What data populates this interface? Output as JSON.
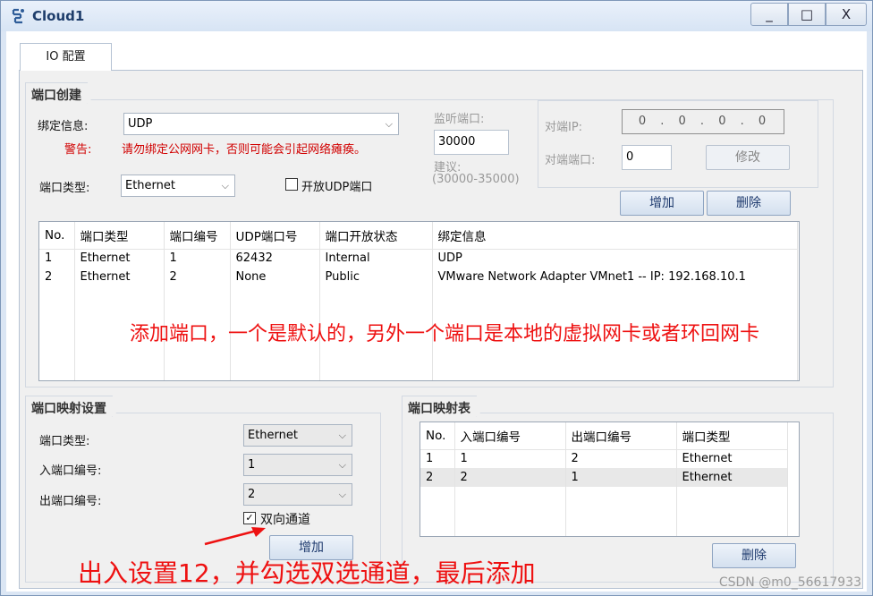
{
  "window": {
    "title": "Cloud1",
    "min_label": "_",
    "max_label": "□",
    "close_label": "X"
  },
  "tab": {
    "label": "IO 配置"
  },
  "port_create": {
    "title": "端口创建",
    "bind_label": "绑定信息:",
    "bind_value": "UDP",
    "warn_label": "警告:",
    "warn_text": "请勿绑定公网网卡，否则可能会引起网络瘫痪。",
    "listen_label": "监听端口:",
    "listen_value": "30000",
    "suggest_label": "建议:",
    "suggest_range": "(30000-35000)",
    "peer_ip_label": "对端IP:",
    "peer_ip_value": "0 . 0 . 0 . 0",
    "peer_port_label": "对端端口:",
    "peer_port_value": "0",
    "modify_label": "修改",
    "port_type_label": "端口类型:",
    "port_type_value": "Ethernet",
    "open_udp_label": "开放UDP端口",
    "add_label": "增加",
    "delete_label": "删除"
  },
  "port_table": {
    "headers": [
      "No.",
      "端口类型",
      "端口编号",
      "UDP端口号",
      "端口开放状态",
      "绑定信息"
    ],
    "rows": [
      [
        "1",
        "Ethernet",
        "1",
        "62432",
        "Internal",
        "UDP"
      ],
      [
        "2",
        "Ethernet",
        "2",
        "None",
        "Public",
        "VMware Network Adapter VMnet1 -- IP: 192.168.10.1"
      ]
    ]
  },
  "mapping_settings": {
    "title": "端口映射设置",
    "port_type_label": "端口类型:",
    "port_type_value": "Ethernet",
    "in_port_label": "入端口编号:",
    "in_port_value": "1",
    "out_port_label": "出端口编号:",
    "out_port_value": "2",
    "bidirectional_label": "双向通道",
    "bidirectional_checked": "✓",
    "add_label": "增加"
  },
  "mapping_table": {
    "title": "端口映射表",
    "headers": [
      "No.",
      "入端口编号",
      "出端口编号",
      "端口类型"
    ],
    "rows": [
      [
        "1",
        "1",
        "2",
        "Ethernet"
      ],
      [
        "2",
        "2",
        "1",
        "Ethernet"
      ]
    ],
    "delete_label": "删除"
  },
  "annotations": {
    "top_note": "添加端口，一个是默认的，另外一个端口是本地的虚拟网卡或者环回网卡",
    "bottom_note": "出入设置12，并勾选双选通道，最后添加",
    "color": "#ee1111"
  },
  "watermark": "CSDN @m0_56617933"
}
